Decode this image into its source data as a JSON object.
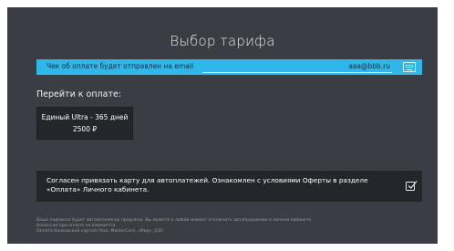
{
  "screen": {
    "title": "Выбор тарифа",
    "email": {
      "label": "Чек об оплате будет отправлен на email",
      "value": "aaa@bbb.ru",
      "icon": "keyboard-icon"
    },
    "payment": {
      "heading": "Перейти к оплате:",
      "plan": {
        "name": "Единый Ultra - 365 дней",
        "price": "2500 ₽"
      }
    },
    "consent": {
      "text": "Согласен привязать карту для автоплатежей. Ознакомлен с условиями Оферты в разделе «Оплата» Личного кабинета.",
      "checked": true,
      "icon": "checkbox-checked-icon"
    },
    "footnote": [
      "Ваша подписка будет автоматически продлена. Вы можете в любой момент отключить автопродление в личном кабинете",
      "Комиссия при оплате не взимается.",
      "Оплата банковской картой (Visa, MasterCard, «Мир», JCB)"
    ]
  },
  "colors": {
    "background": "#3a3d44",
    "accent": "#2fb7ea",
    "card": "#23262b"
  }
}
